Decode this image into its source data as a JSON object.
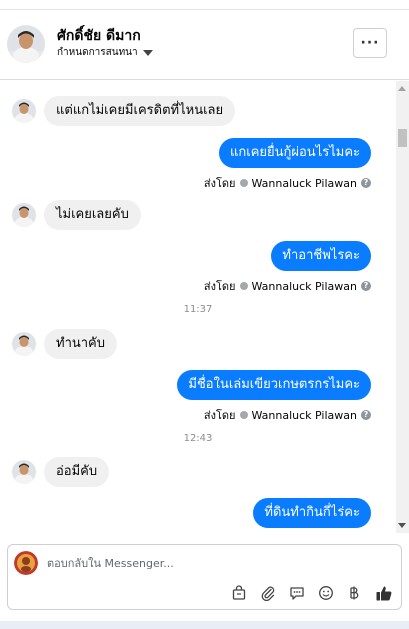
{
  "header": {
    "contact_name": "ศักดิ์ชัย ดีมาก",
    "subtitle": "กำหนดการสนทนา",
    "more_label": "···"
  },
  "messages": [
    {
      "direction": "in",
      "text": "แต่แกไม่เคยมีเครดิตที่ไหนเลย"
    },
    {
      "direction": "out",
      "text": "แกเคยยื่นกู้ผ่อนไรไมคะ",
      "sent_by_label": "ส่งโดย",
      "sender": "Wannaluck Pilawan"
    },
    {
      "direction": "in",
      "text": "ไม่เคยเลยคับ"
    },
    {
      "direction": "out",
      "text": "ทำอาชีพไรคะ",
      "sent_by_label": "ส่งโดย",
      "sender": "Wannaluck Pilawan"
    },
    {
      "direction": "time",
      "text": "11:37"
    },
    {
      "direction": "in",
      "text": "ทำนาคับ"
    },
    {
      "direction": "out",
      "text": "มีชื่อในเล่มเขียวเกษตรกรไมคะ",
      "sent_by_label": "ส่งโดย",
      "sender": "Wannaluck Pilawan"
    },
    {
      "direction": "time",
      "text": "12:43"
    },
    {
      "direction": "in",
      "text": "อ่อมีคับ"
    },
    {
      "direction": "out",
      "text": "ที่ดินทำกินกี่ไร่คะ"
    }
  ],
  "composer": {
    "placeholder": "ตอบกลับใน Messenger..."
  },
  "colors": {
    "accent": "#0a7cff",
    "incoming_bubble": "#f0f0f0"
  },
  "icons": [
    "bag-icon",
    "paperclip-icon",
    "saved-reply-icon",
    "emoji-icon",
    "baht-icon",
    "like-icon"
  ]
}
